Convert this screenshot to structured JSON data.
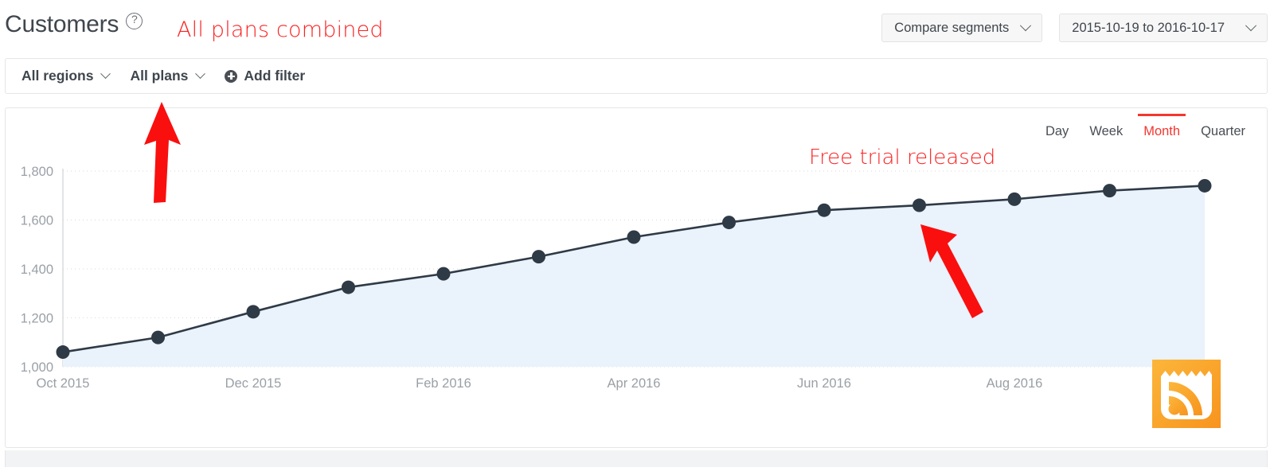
{
  "header": {
    "title": "Customers",
    "help_icon": "question-circle-icon",
    "annotation": "All plans combined",
    "compare_label": "Compare segments",
    "date_range": "2015-10-19 to 2016-10-17"
  },
  "filters": {
    "region": "All regions",
    "plan": "All plans",
    "add_filter": "Add filter"
  },
  "chart_tabs": [
    {
      "label": "Day",
      "active": false
    },
    {
      "label": "Week",
      "active": false
    },
    {
      "label": "Month",
      "active": true
    },
    {
      "label": "Quarter",
      "active": false
    }
  ],
  "annotations": {
    "plans_arrow": "red-up-arrow",
    "trial_text": "Free trial released",
    "trial_arrow": "red-diagonal-arrow"
  },
  "rss_badge": {
    "icon": "rss-feed-icon",
    "color": "#f9a52b"
  },
  "colors": {
    "accent_red": "#f4362f",
    "annotation_red": "#fc2121",
    "line": "#2e3a46",
    "area_fill": "#eaf2fb",
    "axis_text": "#9aa0a6",
    "card_border": "#e6e6e6"
  },
  "chart_data": {
    "type": "area",
    "title": "Customers",
    "xlabel": "",
    "ylabel": "",
    "grid": true,
    "legend": "none",
    "ylim": [
      1000,
      1800
    ],
    "yticks": [
      "1,000",
      "1,200",
      "1,400",
      "1,600",
      "1,800"
    ],
    "ytick_values": [
      1000,
      1200,
      1400,
      1600,
      1800
    ],
    "xticks": [
      "Oct 2015",
      "Dec 2015",
      "Feb 2016",
      "Apr 2016",
      "Jun 2016",
      "Aug 2016"
    ],
    "x": [
      "Oct 2015",
      "Nov 2015",
      "Dec 2015",
      "Jan 2016",
      "Feb 2016",
      "Mar 2016",
      "Apr 2016",
      "May 2016",
      "Jun 2016",
      "Jul 2016",
      "Aug 2016",
      "Sep 2016",
      "Oct 2016"
    ],
    "values": [
      1060,
      1120,
      1225,
      1325,
      1380,
      1450,
      1530,
      1590,
      1640,
      1660,
      1685,
      1720,
      1740
    ],
    "series": [
      {
        "name": "Customers",
        "values": [
          1060,
          1120,
          1225,
          1325,
          1380,
          1450,
          1530,
          1590,
          1640,
          1660,
          1685,
          1720,
          1740
        ]
      }
    ]
  }
}
